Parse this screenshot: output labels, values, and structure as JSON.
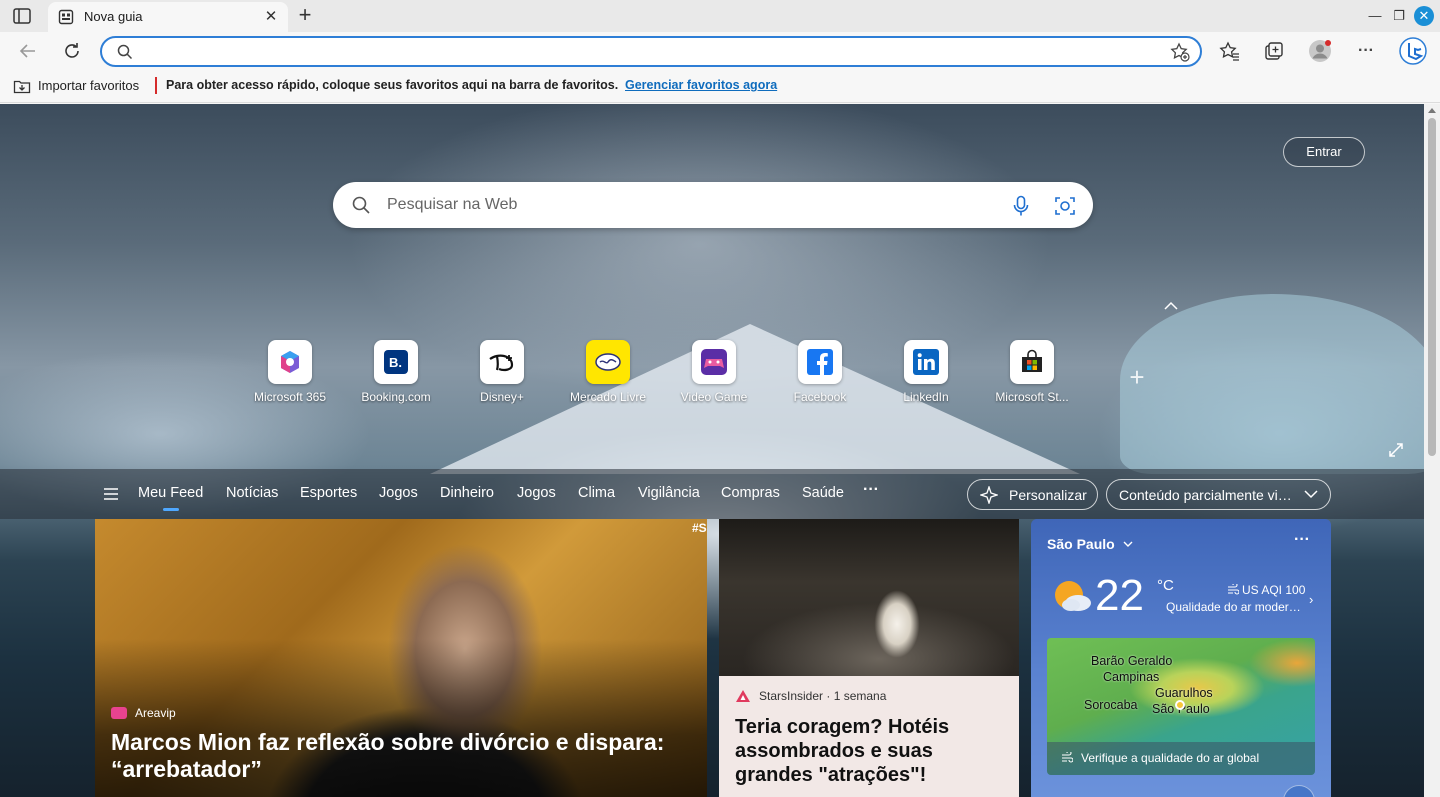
{
  "browser": {
    "tab_title": "Nova guia",
    "tab_close": "✕",
    "new_tab": "+",
    "address_value": "",
    "address_placeholder": "",
    "window": {
      "minimize": "—",
      "restore": "❐",
      "close": "✕"
    }
  },
  "bookmarks_bar": {
    "import_label": "Importar favoritos",
    "hint_text": "Para obter acesso rápido, coloque seus favoritos aqui na barra de favoritos.",
    "manage_link": "Gerenciar favoritos agora"
  },
  "newtab": {
    "sign_in_label": "Entrar",
    "search_placeholder": "Pesquisar na Web",
    "quick_links": [
      {
        "label": "Microsoft 365",
        "icon": "microsoft-365-icon"
      },
      {
        "label": "Booking.com",
        "icon": "booking-icon"
      },
      {
        "label": "Disney+",
        "icon": "disney-plus-icon"
      },
      {
        "label": "Mercado Livre",
        "icon": "mercado-livre-icon"
      },
      {
        "label": "Video Game",
        "icon": "video-game-icon"
      },
      {
        "label": "Facebook",
        "icon": "facebook-icon"
      },
      {
        "label": "LinkedIn",
        "icon": "linkedin-icon"
      },
      {
        "label": "Microsoft St...",
        "icon": "microsoft-store-icon"
      }
    ],
    "add_link": "+"
  },
  "feed": {
    "tabs": [
      "Meu Feed",
      "Notícias",
      "Esportes",
      "Jogos",
      "Dinheiro",
      "Jogos",
      "Clima",
      "Vigilância",
      "Compras",
      "Saúde"
    ],
    "more": "···",
    "personalize_label": "Personalizar",
    "content_select_label": "Conteúdo parcialmente visível"
  },
  "cards": {
    "main": {
      "tag": "#S",
      "source": "Areavip",
      "title": "Marcos Mion faz reflexão sobre divórcio e dispara: “arrebatador”"
    },
    "mid": {
      "source_meta": "StarsInsider · 1 semana",
      "title": "Teria coragem? Hotéis assombrados e suas grandes \"atrações\"!"
    },
    "weather": {
      "city": "São Paulo",
      "more": "···",
      "temperature": "22",
      "unit": "°C",
      "aqi": "US AQI 100",
      "aqi_description": "Qualidade do ar moderada",
      "next": "›",
      "map_labels": [
        "Barão Geraldo",
        "Campinas",
        "Guarulhos",
        "Sorocaba",
        "São Paulo"
      ],
      "map_footer": "Verifique a qualidade do ar global"
    }
  },
  "colors": {
    "accent": "#2e7ed6",
    "link": "#0f6cbd",
    "weather_bg": "#4a72c4"
  }
}
